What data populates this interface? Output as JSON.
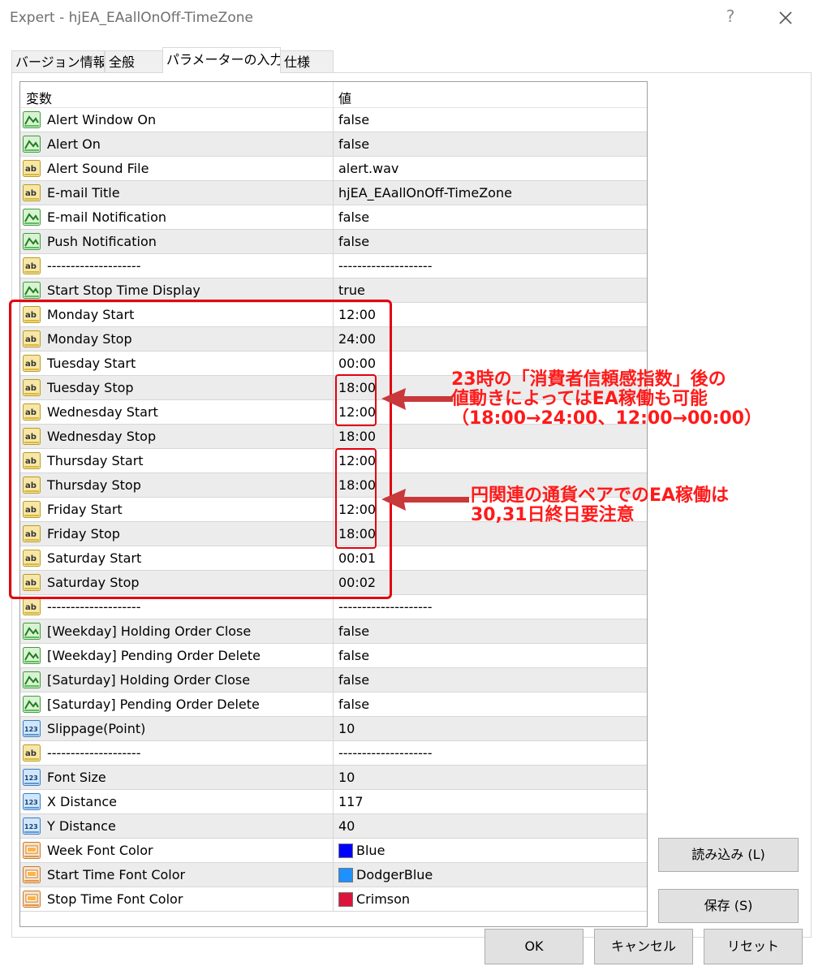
{
  "window": {
    "title": "Expert - hjEA_EAallOnOff-TimeZone",
    "help_glyph": "?",
    "close_glyph": "✕"
  },
  "tabs": [
    {
      "label": "バージョン情報",
      "active": false
    },
    {
      "label": "全般",
      "active": false
    },
    {
      "label": "パラメーターの入力",
      "active": true
    },
    {
      "label": "仕様",
      "active": false
    }
  ],
  "grid": {
    "headers": {
      "variable": "変数",
      "value": "値"
    },
    "rows": [
      {
        "name": "Alert Window On",
        "value": "false",
        "icon": "bool-icon"
      },
      {
        "name": "Alert On",
        "value": "false",
        "icon": "bool-icon"
      },
      {
        "name": "Alert Sound File",
        "value": "alert.wav",
        "icon": "string-icon"
      },
      {
        "name": "E-mail Title",
        "value": "hjEA_EAallOnOff-TimeZone",
        "icon": "string-icon"
      },
      {
        "name": "E-mail Notification",
        "value": "false",
        "icon": "bool-icon"
      },
      {
        "name": "Push Notification",
        "value": "false",
        "icon": "bool-icon"
      },
      {
        "name": "--------------------",
        "value": "--------------------",
        "icon": "string-icon"
      },
      {
        "name": "Start Stop Time Display",
        "value": "true",
        "icon": "bool-icon"
      },
      {
        "name": "Monday Start",
        "value": "12:00",
        "icon": "string-icon"
      },
      {
        "name": "Monday Stop",
        "value": "24:00",
        "icon": "string-icon"
      },
      {
        "name": "Tuesday Start",
        "value": "00:00",
        "icon": "string-icon"
      },
      {
        "name": "Tuesday Stop",
        "value": "18:00",
        "icon": "string-icon"
      },
      {
        "name": "Wednesday Start",
        "value": "12:00",
        "icon": "string-icon"
      },
      {
        "name": "Wednesday Stop",
        "value": "18:00",
        "icon": "string-icon"
      },
      {
        "name": "Thursday Start",
        "value": "12:00",
        "icon": "string-icon"
      },
      {
        "name": "Thursday Stop",
        "value": "18:00",
        "icon": "string-icon"
      },
      {
        "name": "Friday Start",
        "value": "12:00",
        "icon": "string-icon"
      },
      {
        "name": "Friday Stop",
        "value": "18:00",
        "icon": "string-icon"
      },
      {
        "name": "Saturday Start",
        "value": "00:01",
        "icon": "string-icon"
      },
      {
        "name": "Saturday Stop",
        "value": "00:02",
        "icon": "string-icon"
      },
      {
        "name": "--------------------",
        "value": "--------------------",
        "icon": "string-icon"
      },
      {
        "name": "[Weekday]  Holding Order Close",
        "value": "false",
        "icon": "bool-icon"
      },
      {
        "name": "[Weekday]  Pending Order Delete",
        "value": "false",
        "icon": "bool-icon"
      },
      {
        "name": "[Saturday]   Holding Order Close",
        "value": "false",
        "icon": "bool-icon"
      },
      {
        "name": "[Saturday]   Pending Order Delete",
        "value": "false",
        "icon": "bool-icon"
      },
      {
        "name": "Slippage(Point)",
        "value": "10",
        "icon": "int-icon"
      },
      {
        "name": "--------------------",
        "value": "--------------------",
        "icon": "string-icon"
      },
      {
        "name": "Font Size",
        "value": "10",
        "icon": "int-icon"
      },
      {
        "name": "X Distance",
        "value": "117",
        "icon": "int-icon"
      },
      {
        "name": "Y Distance",
        "value": "40",
        "icon": "int-icon"
      },
      {
        "name": "Week Font Color",
        "value": "Blue",
        "icon": "color-icon",
        "swatch": "#0000ff"
      },
      {
        "name": "Start Time Font Color",
        "value": "DodgerBlue",
        "icon": "color-icon",
        "swatch": "#1e90ff"
      },
      {
        "name": "Stop Time Font Color",
        "value": "Crimson",
        "icon": "color-icon",
        "swatch": "#dc143c"
      }
    ]
  },
  "buttons": {
    "load": "読み込み (L)",
    "save": "保存 (S)",
    "ok": "OK",
    "cancel": "キャンセル",
    "reset": "リセット"
  },
  "annotations": {
    "note1": [
      "23時の「消費者信頼感指数」後の",
      "値動きによってはEA稼働も可能",
      "（18:00→24:00、12:00→00:00）"
    ],
    "note2": [
      "円関連の通貨ペアでのEA稼働は",
      "30,31日終日要注意"
    ],
    "color": "#e3000f"
  }
}
